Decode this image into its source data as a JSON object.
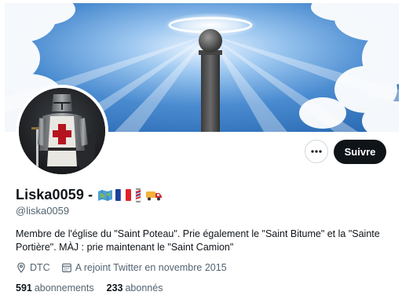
{
  "profile": {
    "display_name": "Liska0059 -",
    "handle": "@liska0059",
    "bio": "Membre de l'église du \"Saint Poteau\". Prie également le \"Saint Bitume\" et la \"Sainte Portière\". MÀJ : prie maintenant le \"Saint Camion\"",
    "location": "DTC",
    "joined": "A rejoint Twitter en novembre 2015",
    "name_emojis": [
      "map-emoji",
      "france-flag-emoji",
      "barber-pole-emoji",
      "truck-emoji"
    ]
  },
  "actions": {
    "follow_label": "Suivre",
    "more_icon": "more-horizontal-icon"
  },
  "stats": {
    "following_count": "591",
    "following_label": "abonnements",
    "followers_count": "233",
    "followers_label": "abonnés"
  },
  "colors": {
    "text_primary": "#0f1419",
    "text_secondary": "#536471",
    "button_dark": "#0f1419",
    "border": "#cfd9de",
    "sky": "#3f80c8"
  }
}
